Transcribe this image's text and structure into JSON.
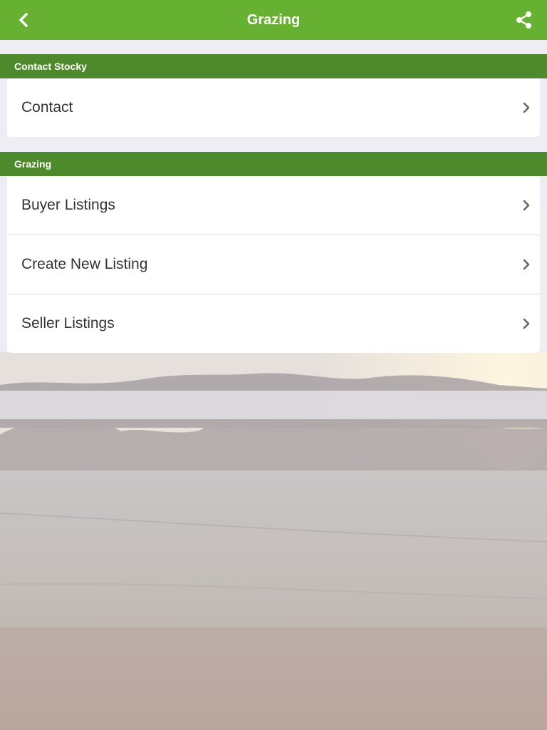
{
  "app": {
    "title": "Grazing"
  },
  "header": {
    "back_icon": "chevron-left-icon",
    "share_icon": "share-icon",
    "background_color": "#66b132"
  },
  "sections": [
    {
      "title": "Contact Stocky",
      "items": [
        {
          "label": "Contact",
          "icon": "chevron-right-icon"
        }
      ]
    },
    {
      "title": "Grazing",
      "items": [
        {
          "label": "Buyer Listings",
          "icon": "chevron-right-icon"
        },
        {
          "label": "Create New Listing",
          "icon": "chevron-right-icon"
        },
        {
          "label": "Seller Listings",
          "icon": "chevron-right-icon"
        }
      ]
    }
  ],
  "colors": {
    "topbar": "#66b132",
    "section_header": "#4e8a2b",
    "row_text": "#333333",
    "chevron": "#666666"
  }
}
